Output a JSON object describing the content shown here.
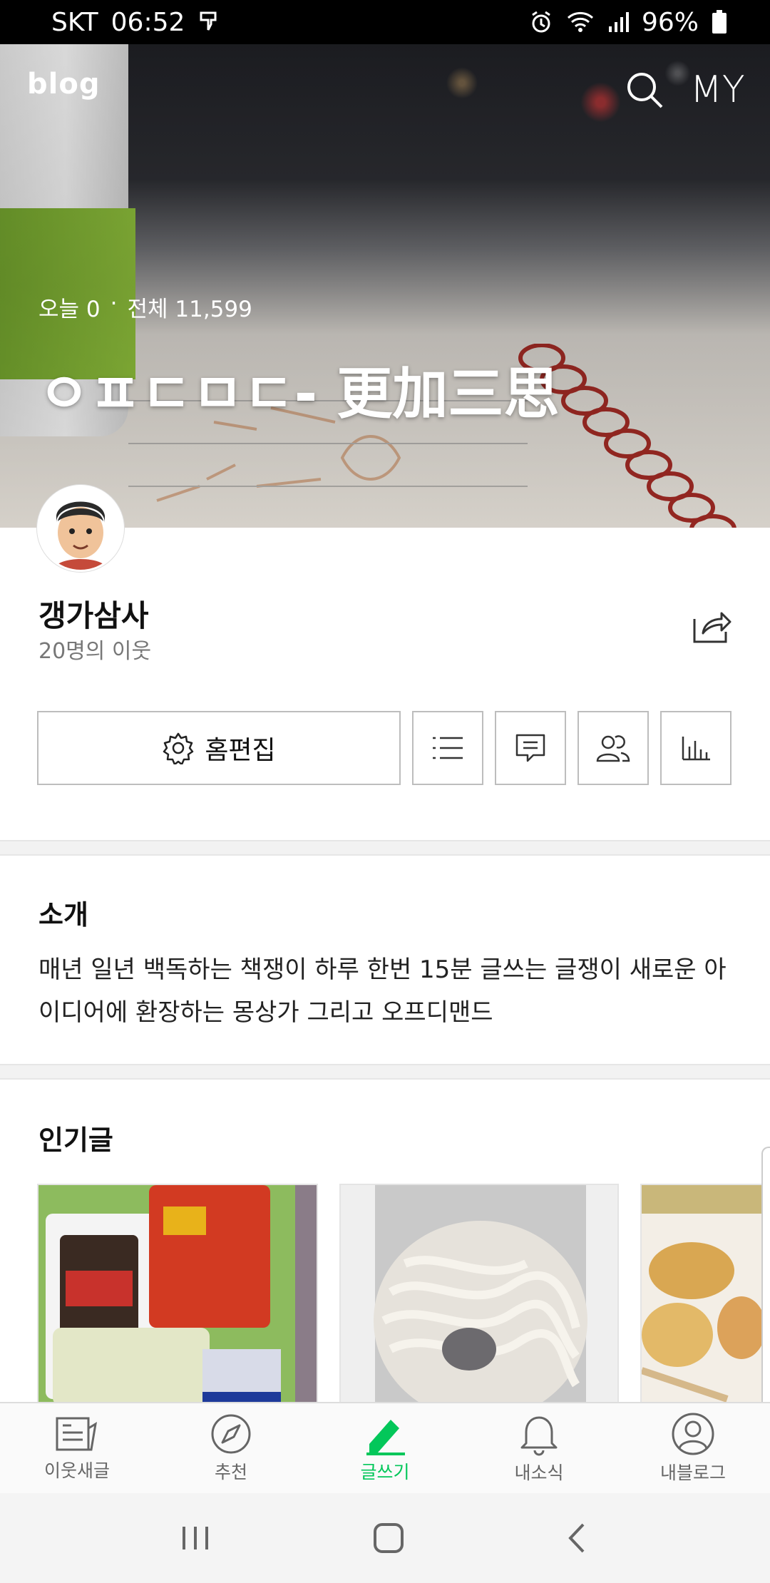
{
  "status_bar": {
    "carrier": "SKT",
    "time": "06:52",
    "battery": "96%"
  },
  "header": {
    "logo": "blog",
    "my_label": "MY"
  },
  "cover": {
    "today_label": "오늘 0",
    "separator": "·",
    "total_label": "전체 11,599",
    "blog_title": "ㅇㅍㄷㅁㄷ- 更加三思"
  },
  "profile": {
    "nickname": "갱가삼사",
    "neighbors": "20명의 이웃"
  },
  "actions": {
    "edit_home_label": "홈편집"
  },
  "intro": {
    "title": "소개",
    "text": "매년 일년 백독하는 책쟁이 하루 한번 15분 글쓰는 글쟁이 새로운 아이디어에 환장하는 몽상가  그리고 오프디맨드"
  },
  "popular": {
    "title": "인기글"
  },
  "tabs": [
    {
      "label": "이웃새글",
      "icon": "news-icon"
    },
    {
      "label": "추천",
      "icon": "compass-icon"
    },
    {
      "label": "글쓰기",
      "icon": "pencil-icon",
      "active": true
    },
    {
      "label": "내소식",
      "icon": "bell-icon"
    },
    {
      "label": "내블로그",
      "icon": "person-icon"
    }
  ],
  "colors": {
    "accent": "#03c75a",
    "status_bar": "#000000"
  }
}
